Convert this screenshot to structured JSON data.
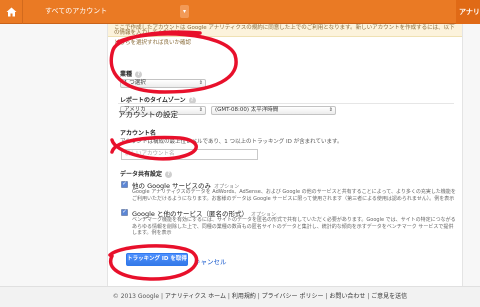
{
  "topbar": {
    "all_accounts": "すべてのアカウント",
    "analytics_tab": "アナリティクス",
    "home_icon": "home-icon",
    "accent": "#ea7a24"
  },
  "notice": {
    "text": "ここで作成したアカウントは Google アナリティクスの規約に同意した上でのご利用となります。新しいアカウントを作成するには、以下の情報を入力してください。",
    "link": "どちらを選択すれば良いか確認"
  },
  "form": {
    "industry_label": "業種",
    "industry_value": "1 つ選択",
    "timezone_label": "レポートのタイムゾーン",
    "country_value": "アメリカ",
    "timezone_value": "(GMT-08:00) 太平洋時間",
    "account_settings_title": "アカウントの設定",
    "account_name_label": "アカウント名",
    "account_name_help": "アカウントは構成の最上位レベルであり、1 つ以上のトラッキング ID が含まれています。",
    "account_name_placeholder": "新しいアカウント名",
    "data_sharing_label": "データ共有設定",
    "google_products_title": "他の Google サービスのみ",
    "google_products_opt": "オプション",
    "google_products_desc": "Google アナリティクスのデータを AdWords、AdSense、および Google の他のサービスと共有することによって、より多くの充実した機能をご利用いただけるようになります。お客様のデータは Google サービスに限って使用されます（第三者による使用は認められません）。例を表示",
    "anonymous_title": "Google と他のサービス（匿名の形式）",
    "anonymous_opt": "オプション",
    "anonymous_desc": "ベンチマーク機能を有効にするには、サイトのデータを匿名の形式で共有していただく必要があります。Google では、サイトの特定につながるあらゆる情報を削除した上で、同種の業種の数百もの匿名サイトのデータと集計し、統計的な傾向を示すデータをベンチマーク サービスで提供します。例を表示",
    "submit_label": "トラッキング ID を取得",
    "cancel_label": "キャンセル"
  },
  "footer": {
    "copyright": "© 2013 Google",
    "links": [
      "アナリティクス ホーム",
      "利用規約",
      "プライバシー ポリシー",
      "お問い合わせ",
      "ご意見を送信"
    ],
    "separator": " | "
  },
  "annotation_color": "#e8102b"
}
